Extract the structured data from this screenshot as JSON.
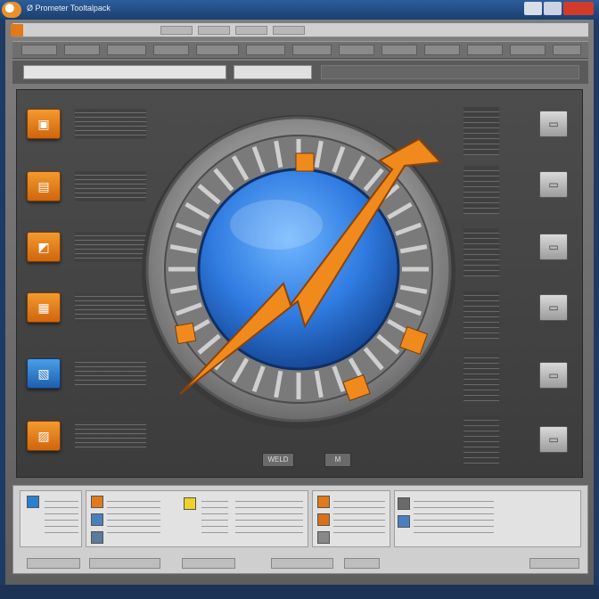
{
  "window": {
    "title": "Ø Prometer Tooltalpack",
    "controls": {
      "minimize": "",
      "maximize": "",
      "close": ""
    }
  },
  "toolbar": {
    "label": ""
  },
  "address": {
    "value": "",
    "placeholder": ""
  },
  "sidebar": {
    "items": [
      {
        "icon": "folder-icon",
        "glyph": "▣"
      },
      {
        "icon": "image-icon",
        "glyph": "▤"
      },
      {
        "icon": "photo-icon",
        "glyph": "◩"
      },
      {
        "icon": "document-icon",
        "glyph": "▦"
      },
      {
        "icon": "blue-doc-icon",
        "glyph": "▧"
      },
      {
        "icon": "chart-icon",
        "glyph": "▨"
      }
    ]
  },
  "right_panel": {
    "items": [
      {
        "icon": "drive-icon"
      },
      {
        "icon": "drive-icon"
      },
      {
        "icon": "monitor-icon"
      },
      {
        "icon": "disk-icon"
      },
      {
        "icon": "window-icon"
      },
      {
        "icon": "drive-icon"
      }
    ]
  },
  "center": {
    "hero_icon": "performance-gauge-icon",
    "zoom_label": "WELD",
    "page_label": "M"
  },
  "bottom": {
    "cards": 4
  },
  "status": {
    "left": "",
    "right": ""
  },
  "colors": {
    "accent_orange": "#f08a1c",
    "globe_blue": "#2f7be0",
    "titlebar": "#2c5d9c"
  }
}
